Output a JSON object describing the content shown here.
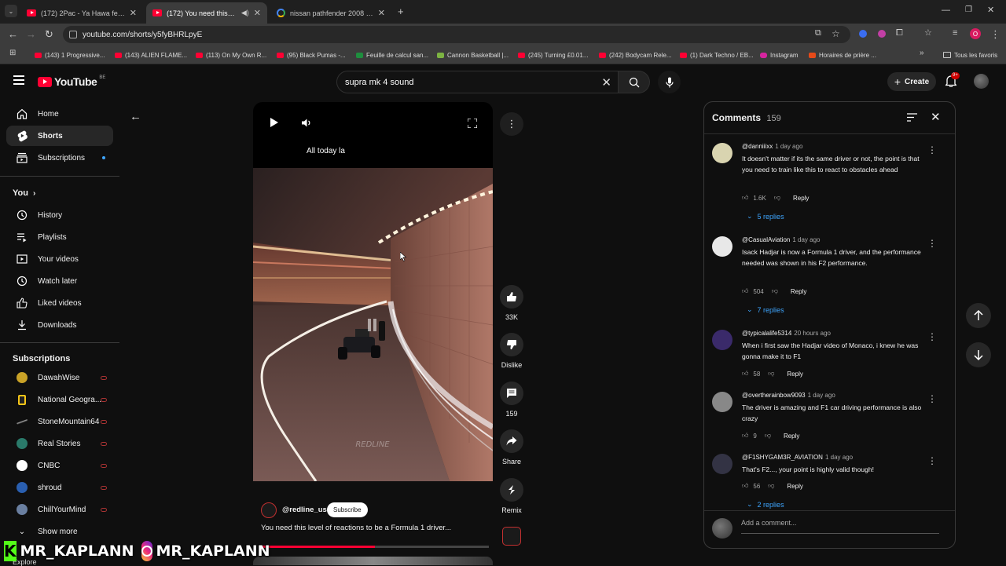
{
  "browser": {
    "tabs": [
      {
        "title": "(172) 2Pac - Ya Hawa feat. Faïs",
        "active": false
      },
      {
        "title": "(172) You need this level of",
        "active": true
      },
      {
        "title": "nissan pathfender 2008 - Goog",
        "active": false
      }
    ],
    "url": "youtube.com/shorts/y5fyBHRLpyE",
    "bookmarks": [
      "(143) 1 Progressive...",
      "(143) ALIEN FLAME...",
      "(113) On My Own R...",
      "(95) Black Pumas -...",
      "Feuille de calcul san...",
      "Cannon Basketball |...",
      "(245) Turning £0.01...",
      "(242) Bodycam Rele...",
      "(1) Dark Techno / EB...",
      "Instagram",
      "Horaires de prière ..."
    ],
    "all_bookmarks": "Tous les favoris",
    "profile_letter": "O",
    "accent": "#ff0033"
  },
  "header": {
    "logo": "YouTube",
    "country": "BE",
    "search_value": "supra mk 4 sound",
    "create": "Create",
    "notif_count": "9+"
  },
  "sidebar": {
    "main": [
      {
        "label": "Home",
        "icon": "home-icon"
      },
      {
        "label": "Shorts",
        "icon": "shorts-icon"
      },
      {
        "label": "Subscriptions",
        "icon": "subscriptions-icon"
      }
    ],
    "you_heading": "You",
    "you": [
      {
        "label": "History",
        "icon": "history-icon"
      },
      {
        "label": "Playlists",
        "icon": "playlists-icon"
      },
      {
        "label": "Your videos",
        "icon": "your-videos-icon"
      },
      {
        "label": "Watch later",
        "icon": "watch-later-icon"
      },
      {
        "label": "Liked videos",
        "icon": "liked-videos-icon"
      },
      {
        "label": "Downloads",
        "icon": "downloads-icon"
      }
    ],
    "subs_heading": "Subscriptions",
    "subscriptions": [
      {
        "label": "DawahWise",
        "color": "#c9a227"
      },
      {
        "label": "National Geogra...",
        "color": "#f5c518"
      },
      {
        "label": "StoneMountain64",
        "color": "#666666"
      },
      {
        "label": "Real Stories",
        "color": "#2a7a6a"
      },
      {
        "label": "CNBC",
        "color": "#ffffff"
      },
      {
        "label": "shroud",
        "color": "#2a5fb0"
      },
      {
        "label": "ChillYourMind",
        "color": "#6a7fa0"
      }
    ],
    "show_more": "Show more",
    "explore": "Explore"
  },
  "video": {
    "caption": "All today la",
    "watermark": "REDLINE",
    "channel": "@redline_us",
    "subscribe": "Subscribe",
    "title": "You need this level of reactions to be a Formula 1 driver...",
    "progress": 0.5
  },
  "actions": {
    "likes": "33K",
    "dislike": "Dislike",
    "comments": "159",
    "share": "Share",
    "remix": "Remix"
  },
  "comments_panel": {
    "title": "Comments",
    "count": "159",
    "add_placeholder": "Add a comment...",
    "items": [
      {
        "author": "@danniiixx",
        "time": "1 day ago",
        "text": "It doesn't matter if its the same driver or not, the point is that you need to train like this to react to obstacles ahead",
        "likes": "1.6K",
        "reply": "Reply",
        "replies": "5 replies",
        "color": "#d9d4b0"
      },
      {
        "author": "@CasualAviation",
        "time": "1 day ago",
        "text": "Isack Hadjar is now a Formula 1 driver, and the performance needed was shown in his F2 performance.",
        "likes": "504",
        "reply": "Reply",
        "replies": "7 replies",
        "color": "#e8e8e8"
      },
      {
        "author": "@typicalalife5314",
        "time": "20 hours ago",
        "text": "When i first saw the Hadjar video of Monaco, i knew he was gonna make it to F1",
        "likes": "58",
        "reply": "Reply",
        "replies": "",
        "color": "#3a2a6a"
      },
      {
        "author": "@overtherainbow9093",
        "time": "1 day ago",
        "text": "The driver is amazing and F1 car driving performance is also crazy",
        "likes": "9",
        "reply": "Reply",
        "replies": "",
        "color": "#888888"
      },
      {
        "author": "@F1SHYGAM3R_AVIATION",
        "time": "1 day ago",
        "text": "That's F2..., your point is highly valid though!",
        "likes": "56",
        "reply": "Reply",
        "replies": "2 replies",
        "color": "#333344"
      }
    ]
  },
  "overlay": {
    "left_handle": "MR_KAPLANN",
    "right_handle": "MR_KAPLANN"
  }
}
